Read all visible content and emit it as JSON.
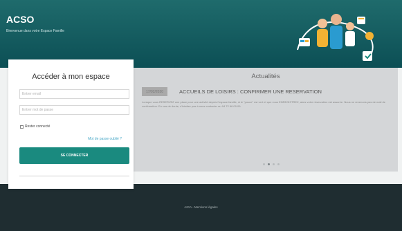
{
  "header": {
    "brand": "ACSO",
    "welcome": "Bienvenue dans votre Espace Famille"
  },
  "login": {
    "title": "Accéder à mon espace",
    "email_placeholder": "Entrer email",
    "password_placeholder": "Entrer mot de passe",
    "remember_label": "Rester connecté",
    "forgot_label": "Mot de passe oublié ?",
    "connect_label": "SE CONNECTER"
  },
  "news": {
    "title": "Actualités",
    "date": "17/02/2020",
    "headline": "ACCUEILS DE LOISIRS : CONFIRMER UNE RESERVATION",
    "body": "Lorsque vous RESERVEZ une place pour une activité depuis l'espace famille, si le \"pouce\" est vert et que vous ENREGISTREZ, alors votre réservation est assurée. Nous ne revenons pas de mail de confirmation. En cas de doute, n'hésitez pas à nous contacter au 04 72 66 09 09.",
    "slides": 4,
    "active_slide": 2
  },
  "footer": {
    "text": "AIGA  -  Mentions légales"
  },
  "colors": {
    "header_start": "#1f6b6c",
    "header_end": "#0c4f55",
    "accent": "#1a8a7f",
    "link": "#45a6c6",
    "footer_bg": "#1f2d31"
  }
}
